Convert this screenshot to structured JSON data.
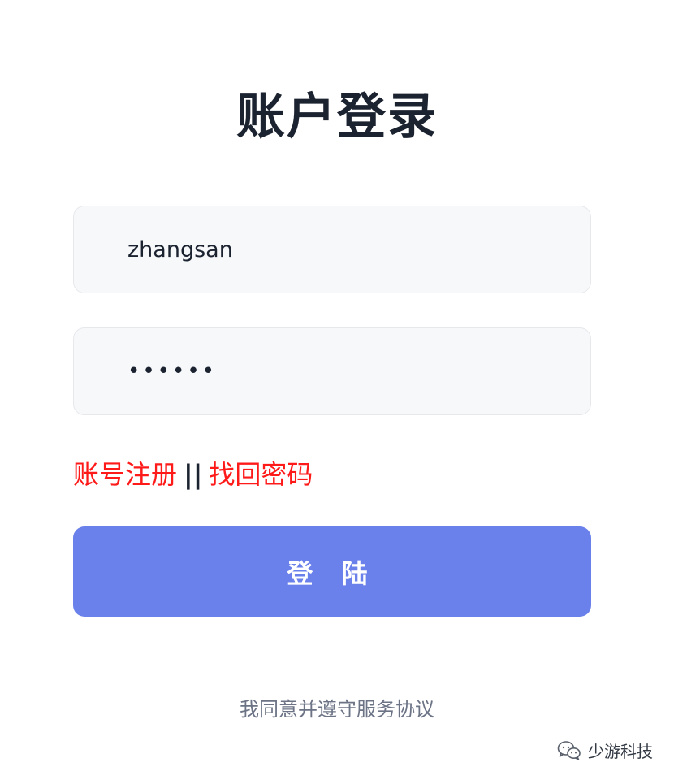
{
  "page": {
    "title": "账户登录"
  },
  "form": {
    "username_value": "zhangsan",
    "password_value": "••••••"
  },
  "links": {
    "register": "账号注册",
    "separator": "||",
    "forgot_password": "找回密码"
  },
  "login_button": {
    "label": "登 陆"
  },
  "agreement": {
    "text": "我同意并遵守服务协议"
  },
  "watermark": {
    "text": "少游科技",
    "icon": "wechat-icon"
  },
  "colors": {
    "title": "#1c2330",
    "link": "#ff1a1a",
    "button": "#6a80ea",
    "field_bg": "#f7f8fa",
    "muted_text": "#6b7385"
  }
}
